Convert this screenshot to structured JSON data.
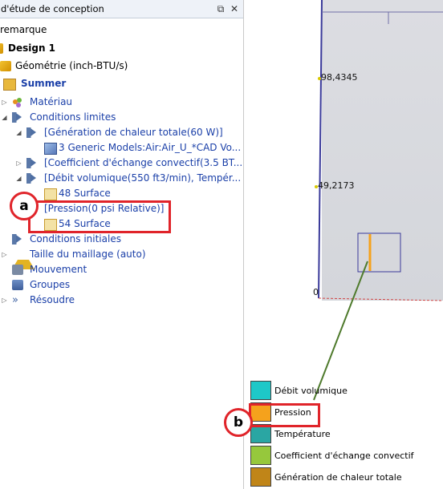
{
  "panel": {
    "title": "d'étude de conception",
    "pin_icon": "pin-icon",
    "close_icon": "close-icon"
  },
  "tree": {
    "remarque": "remarque",
    "design": "Design 1",
    "geometry": "Géométrie (inch-BTU/s)",
    "scenario": "Summer",
    "material": "Matériau",
    "boundary_conditions": "Conditions limites",
    "heat_gen": "[Génération de chaleur totale(60 W)]",
    "heat_gen_child": "3 Generic Models:Air:Air_U_*CAD Vo...",
    "conv_coeff": "[Coefficient d'échange convectif(3.5 BT...",
    "vol_flow": "[Débit volumique(550 ft3/min), Tempér...",
    "vol_flow_child": "48 Surface",
    "pressure": "[Pression(0 psi Relative)]",
    "pressure_child": "54 Surface",
    "initial_conditions": "Conditions initiales",
    "mesh_size": "Taille du maillage (auto)",
    "motion": "Mouvement",
    "groups": "Groupes",
    "solve": "Résoudre"
  },
  "callouts": {
    "a": "a",
    "b": "b"
  },
  "viewport": {
    "label_top": "98,4345",
    "label_mid": "49,2173",
    "label_bottom": "0"
  },
  "legend": [
    {
      "label": "Débit volumique",
      "color": "#1ec8c8"
    },
    {
      "label": "Pression",
      "color": "#f5a21c"
    },
    {
      "label": "Température",
      "color": "#2aa6a3"
    },
    {
      "label": "Coefficient d'échange convectif",
      "color": "#96c83c"
    },
    {
      "label": "Génération de chaleur totale",
      "color": "#c08518"
    }
  ],
  "colors": {
    "accent": "#e0242a",
    "link_blue": "#1a3fa8",
    "leader_line": "#4e7a2c"
  }
}
